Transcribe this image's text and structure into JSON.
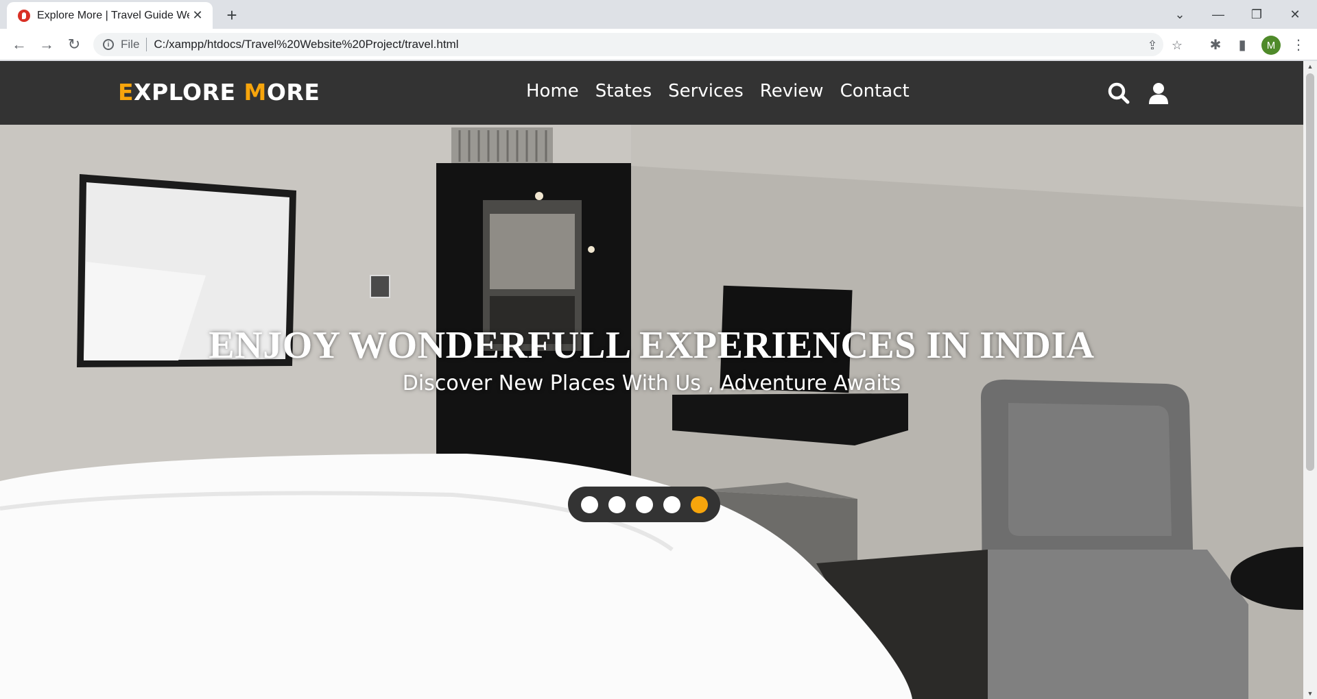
{
  "browser": {
    "tab_title": "Explore More | Travel Guide Website",
    "new_tab": "+",
    "omnibox": {
      "scheme_label": "File",
      "url": "C:/xampp/htdocs/Travel%20Website%20Project/travel.html"
    },
    "profile_initial": "M"
  },
  "site": {
    "logo": {
      "first_initial": "E",
      "first_rest": "XPLORE ",
      "second_initial": "M",
      "second_rest": "ORE"
    },
    "nav": [
      "Home",
      "States",
      "Services",
      "Review",
      "Contact"
    ],
    "hero": {
      "title": "ENJOY WONDERFULL EXPERIENCES IN INDIA",
      "subtitle": "Discover New Places With Us , Adventure Awaits"
    },
    "slider": {
      "count": 5,
      "active_index": 4
    }
  },
  "colors": {
    "accent": "#f7a50c",
    "header_bg": "#333333",
    "profile_bg": "#4f8a2a"
  }
}
